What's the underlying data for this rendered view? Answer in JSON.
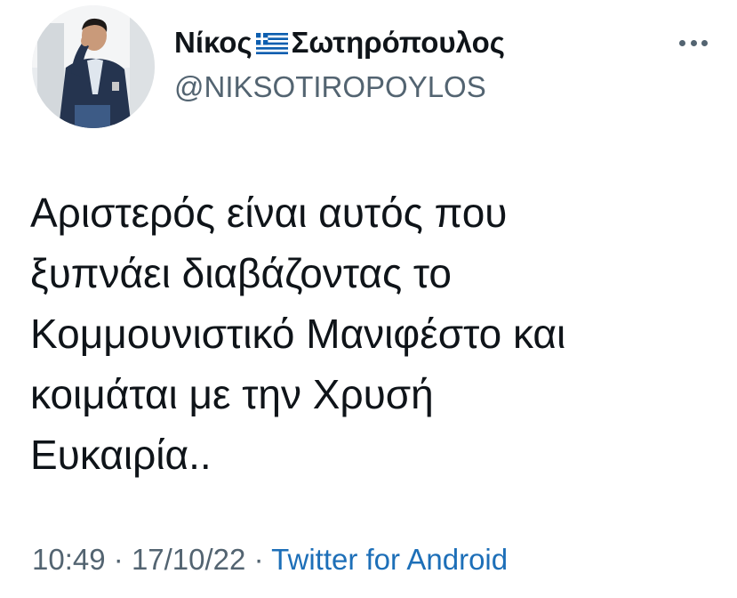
{
  "tweet": {
    "author": {
      "name_first": "Νίκος",
      "name_last": "Σωτηρόπουλος",
      "flag_icon": "greek-flag-emoji",
      "handle": "@NIKSOTIROPOYLOS"
    },
    "more_icon": "more-options-icon",
    "text_lines": [
      "Αριστερός είναι αυτός που",
      "ξυπνάει διαβάζοντας το",
      "Κομμουνιστικό Μανιφέστο και",
      "κοιμάται με την Χρυσή",
      "Ευκαιρία.."
    ],
    "time": "10:49",
    "date": "17/10/22",
    "separator": "·",
    "source": "Twitter for Android"
  },
  "colors": {
    "text": "#0f1419",
    "secondary": "#536471",
    "link": "#1d6fb8"
  }
}
